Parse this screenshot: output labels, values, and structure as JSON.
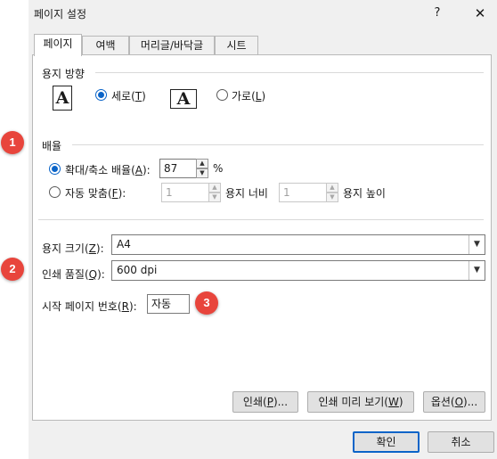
{
  "window": {
    "title": "페이지 설정",
    "help": "?",
    "close": "✕"
  },
  "tabs": [
    "페이지",
    "여백",
    "머리글/바닥글",
    "시트"
  ],
  "orientation": {
    "label": "용지 방향",
    "icon_glyph": "A",
    "portrait_text": "세로(",
    "portrait_key": "T",
    "landscape_text": "가로(",
    "landscape_key": "L",
    "close_paren": ")",
    "selected": "portrait"
  },
  "scaling": {
    "label": "배율",
    "adjust_text": "확대/축소 배율(",
    "adjust_key": "A",
    "adjust_suffix": "):",
    "adjust_value": "87",
    "percent": "%",
    "fit_text": "자동 맞춤(",
    "fit_key": "F",
    "fit_suffix": "):",
    "fit_wide_value": "1",
    "fit_wide_label": "용지 너비",
    "fit_tall_value": "1",
    "fit_tall_label": "용지 높이",
    "selected": "adjust"
  },
  "paper_size": {
    "label_text": "용지 크기(",
    "label_key": "Z",
    "label_suffix": "):",
    "value": "A4"
  },
  "print_quality": {
    "label_text": "인쇄 품질(",
    "label_key": "Q",
    "label_suffix": "):",
    "value": "600 dpi"
  },
  "first_page": {
    "label_text": "시작 페이지 번호(",
    "label_key": "R",
    "label_suffix": "):",
    "value": "자동"
  },
  "buttons": {
    "print_text": "인쇄(",
    "print_key": "P",
    "print_suffix": ")...",
    "preview_text": "인쇄 미리 보기(",
    "preview_key": "W",
    "preview_suffix": ")",
    "options_text": "옵션(",
    "options_key": "O",
    "options_suffix": ")...",
    "ok": "확인",
    "cancel": "취소"
  },
  "annotations": [
    "1",
    "2",
    "3"
  ],
  "colors": {
    "accent": "#0a64c8",
    "badge": "#e8453c",
    "dialog_bg": "#f0f0f0"
  }
}
